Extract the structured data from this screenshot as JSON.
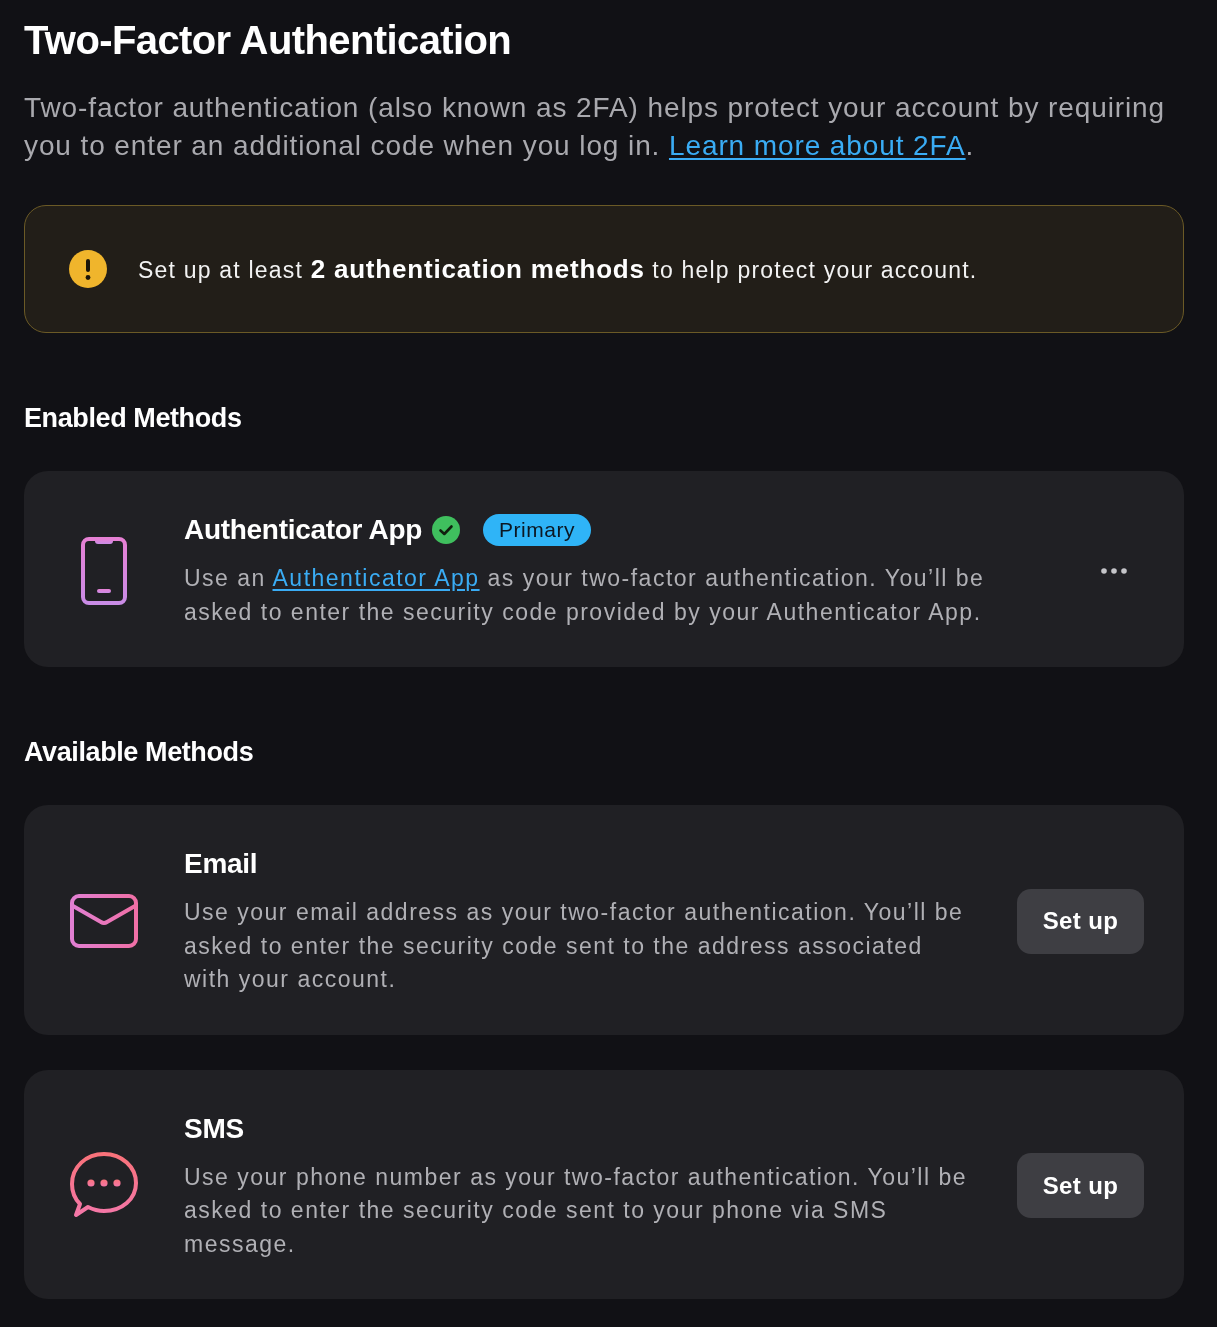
{
  "header": {
    "title": "Two-Factor Authentication",
    "intro": [
      {
        "kind": "text",
        "text": "Two-factor authentication (also known as 2FA) helps protect your account by requiring you to enter an additional code when you log in. "
      },
      {
        "kind": "link",
        "text": "Learn more about 2FA"
      },
      {
        "kind": "text",
        "text": "."
      }
    ]
  },
  "notice": {
    "text": "Set up at least **2 authentication methods** to help protect your account."
  },
  "sections": [
    {
      "heading": "Enabled Methods",
      "methods": [
        {
          "kind": "app",
          "name": "Authenticator App",
          "verified": true,
          "badge": "Primary",
          "description": [
            {
              "kind": "text",
              "text": "Use an "
            },
            {
              "kind": "link",
              "text": "Authenticator App"
            },
            {
              "kind": "text",
              "text": " as your two-factor authentication. You’ll be asked to enter the security code provided by your Authenticator App."
            }
          ],
          "action": {
            "kind": "menu"
          }
        }
      ]
    },
    {
      "heading": "Available Methods",
      "methods": [
        {
          "kind": "email",
          "name": "Email",
          "verified": false,
          "description": [
            {
              "kind": "text",
              "text": "Use your email address as your two-factor authentication. You’ll be asked to enter the security code sent to the address associated with your account."
            }
          ],
          "action": {
            "kind": "button",
            "label": "Set up"
          }
        },
        {
          "kind": "sms",
          "name": "SMS",
          "verified": false,
          "description": [
            {
              "kind": "text",
              "text": "Use your phone number as your two-factor authentication. You’ll be asked to enter the security code sent to your phone via SMS message."
            }
          ],
          "action": {
            "kind": "button",
            "label": "Set up"
          }
        }
      ]
    }
  ]
}
